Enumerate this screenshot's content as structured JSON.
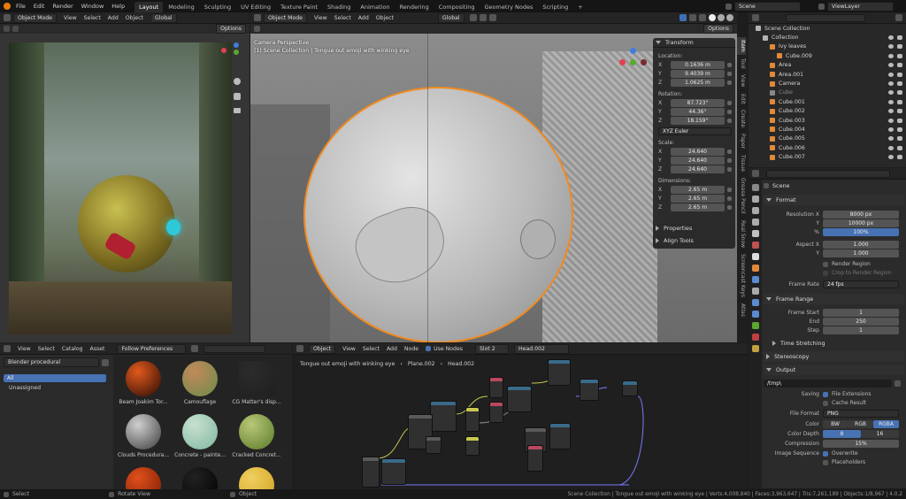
{
  "menu": [
    "File",
    "Edit",
    "Render",
    "Window",
    "Help"
  ],
  "workspaces": [
    "Layout",
    "Modeling",
    "Sculpting",
    "UV Editing",
    "Texture Paint",
    "Shading",
    "Animation",
    "Rendering",
    "Compositing",
    "Geometry Nodes",
    "Scripting"
  ],
  "active_workspace": "Layout",
  "scene": {
    "scene_name": "Scene",
    "view_layer": "ViewLayer"
  },
  "left_viewport": {
    "mode": "Object Mode",
    "menus": [
      "View",
      "Select",
      "Add",
      "Object"
    ],
    "options": "Options",
    "transform": "Global"
  },
  "main_viewport": {
    "mode": "Object Mode",
    "menus": [
      "View",
      "Select",
      "Add",
      "Object"
    ],
    "transform": "Global",
    "options": "Options",
    "overlay_title": "Camera Perspective",
    "overlay_sub": "(1) Scene Collection | Tongue out emoji with winking eye"
  },
  "n_panel": {
    "title": "Transform",
    "location_label": "Location:",
    "location": [
      {
        "axis": "X",
        "value": "0.1636 m"
      },
      {
        "axis": "Y",
        "value": "9.4039 m"
      },
      {
        "axis": "Z",
        "value": "1.0625 m"
      }
    ],
    "rotation_label": "Rotation:",
    "rotation": [
      {
        "axis": "X",
        "value": "87.723°"
      },
      {
        "axis": "Y",
        "value": "44.36°"
      },
      {
        "axis": "Z",
        "value": "18.159°"
      }
    ],
    "rotation_mode": "XYZ Euler",
    "scale_label": "Scale:",
    "scale": [
      {
        "axis": "X",
        "value": "24.640"
      },
      {
        "axis": "Y",
        "value": "24.640"
      },
      {
        "axis": "Z",
        "value": "24.640"
      }
    ],
    "dimensions_label": "Dimensions:",
    "dimensions": [
      {
        "axis": "X",
        "value": "2.65 m"
      },
      {
        "axis": "Y",
        "value": "2.65 m"
      },
      {
        "axis": "Z",
        "value": "2.65 m"
      }
    ],
    "properties": "Properties",
    "align_tools": "Align Tools"
  },
  "side_tabs": [
    "Item",
    "Tool",
    "View",
    "Edit",
    "Create",
    "Paper",
    "Tissue",
    "Grease Pencil",
    "Real Snow",
    "Screencast Keys",
    "Atlas"
  ],
  "outliner": {
    "root": "Scene Collection",
    "items": [
      {
        "name": "Collection",
        "color": "#b4b4b4"
      },
      {
        "name": "Ivy leaves",
        "color": "#e0893b"
      },
      {
        "name": "Cube.009",
        "color": "#e0893b"
      },
      {
        "name": "Area",
        "color": "#e0893b"
      },
      {
        "name": "Area.001",
        "color": "#e0893b"
      },
      {
        "name": "Camera",
        "color": "#e0893b"
      },
      {
        "name": "Cube",
        "color": "#888888"
      },
      {
        "name": "Cube.001",
        "color": "#e0893b"
      },
      {
        "name": "Cube.002",
        "color": "#e0893b"
      },
      {
        "name": "Cube.003",
        "color": "#e0893b"
      },
      {
        "name": "Cube.004",
        "color": "#e0893b"
      },
      {
        "name": "Cube.005",
        "color": "#e0893b"
      },
      {
        "name": "Cube.006",
        "color": "#e0893b"
      },
      {
        "name": "Cube.007",
        "color": "#e0893b"
      }
    ]
  },
  "properties": {
    "context": "Scene",
    "format": {
      "title": "Format",
      "res_x_label": "Resolution X",
      "res_x": "8000 px",
      "res_y_label": "Y",
      "res_y": "10000 px",
      "pct_label": "%",
      "pct": "100%",
      "aspect_x_label": "Aspect X",
      "aspect_x": "1.000",
      "aspect_y_label": "Y",
      "aspect_y": "1.000",
      "render_region": "Render Region",
      "crop": "Crop to Render Region",
      "frame_rate_label": "Frame Rate",
      "frame_rate": "24 fps"
    },
    "frame_range": {
      "title": "Frame Range",
      "start_label": "Frame Start",
      "start": "1",
      "end_label": "End",
      "end": "250",
      "step_label": "Step",
      "step": "1"
    },
    "time_stretching": "Time Stretching",
    "stereoscopy": "Stereoscopy",
    "output": {
      "title": "Output",
      "path": "/tmp\\",
      "saving_label": "Saving",
      "file_ext": "File Extensions",
      "cache": "Cache Result",
      "format_label": "File Format",
      "format": "PNG",
      "color_label": "Color",
      "color_opts": [
        "BW",
        "RGB",
        "RGBA"
      ],
      "depth_label": "Color Depth",
      "depth_opts": [
        "8",
        "16"
      ],
      "compression_label": "Compression",
      "compression": "15%",
      "img_seq_label": "Image Sequence",
      "overwrite": "Overwrite",
      "placeholders": "Placeholders"
    }
  },
  "asset_browser": {
    "menus": [
      "View",
      "Select",
      "Catalog",
      "Asset"
    ],
    "import": "Follow Preferences",
    "library": "Blender procedural",
    "catalogs": [
      "All",
      "Unassigned"
    ],
    "assets": [
      {
        "name": "Beam Joakim Tor...",
        "c1": "#2a0a05",
        "c2": "#e05a1c"
      },
      {
        "name": "Camouflage",
        "c1": "#6c8a4a",
        "c2": "#c28a5a"
      },
      {
        "name": "CG Matter's disp...",
        "c1": "#1f1f1f",
        "c2": "#2c2c2c"
      },
      {
        "name": "Clouds Procedura...",
        "c1": "#3c3c3c",
        "c2": "#d0d0d0"
      },
      {
        "name": "Concrete - painte...",
        "c1": "#7fb8a0",
        "c2": "#c8e0d0"
      },
      {
        "name": "Cracked Concret...",
        "c1": "#5a7a28",
        "c2": "#b8c878"
      },
      {
        "name": "",
        "c1": "#7a1a05",
        "c2": "#e0501a"
      },
      {
        "name": "",
        "c1": "#000000",
        "c2": "#222222"
      },
      {
        "name": "",
        "c1": "#d0a020",
        "c2": "#f0d060"
      }
    ]
  },
  "node_editor": {
    "type": "Object",
    "menus": [
      "View",
      "Select",
      "Add",
      "Node"
    ],
    "use_nodes": "Use Nodes",
    "slot": "Slot 2",
    "material": "Head.002",
    "breadcrumb": [
      "Tongue out emoji with winking eye",
      "Plane.002",
      "Head.002"
    ]
  },
  "status": {
    "left": "Select",
    "mid": "Rotate View",
    "right_action": "Object",
    "stats": "Scene Collection | Tongue out emoji with winking eye | Verts:4,008,840 | Faces:3,963,647 | Tris:7,261,189 | Objects:1/8,967 | 4.0.2"
  }
}
